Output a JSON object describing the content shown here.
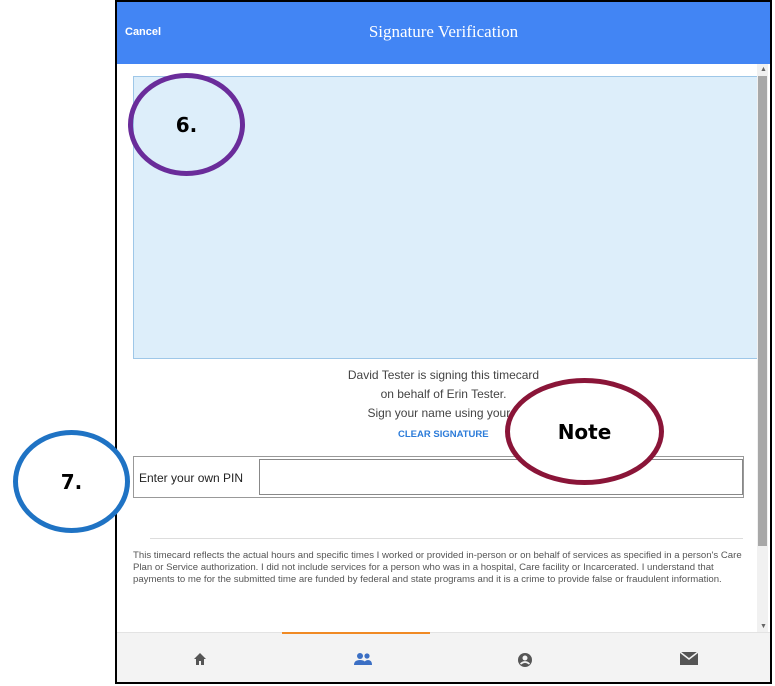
{
  "header": {
    "cancel_label": "Cancel",
    "title": "Signature Verification"
  },
  "signature_info": {
    "line1": "David Tester is signing this timecard",
    "line2": "on behalf of  Erin Tester.",
    "line3": "Sign your name using your fi",
    "clear_label": "CLEAR SIGNATURE"
  },
  "pin": {
    "label": "Enter your own PIN",
    "value": ""
  },
  "legal_text": "This timecard reflects the actual hours and specific times I worked or provided in-person or on behalf of services as specified in a person's Care Plan or Service authorization. I did not include services for a person who was in a hospital, Care facility or Incarcerated. I understand that payments to me for the submitted time are funded by federal and state programs and it is a crime to provide false or fraudulent information.",
  "nav": {
    "items": [
      "home-icon",
      "people-icon",
      "account-icon",
      "mail-icon"
    ],
    "active": "people-icon"
  },
  "callouts": {
    "six": "6.",
    "seven": "7.",
    "note": "Note"
  },
  "colors": {
    "header": "#4285f4",
    "signature_pad": "#ddeefa",
    "accent": "#f08a24",
    "callout_six": "#6a2c9a",
    "callout_seven": "#1f73c4",
    "callout_note": "#8a1538"
  }
}
